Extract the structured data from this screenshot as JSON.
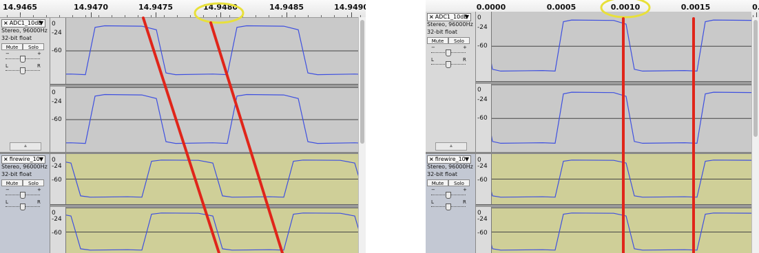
{
  "left": {
    "ruler_labels": [
      "14.9465",
      "14.9470",
      "14.9475",
      "14.9480",
      "14.9485",
      "14.9490"
    ],
    "highlighted_label_index": 3
  },
  "right": {
    "ruler_labels": [
      "0.0000",
      "0.0005",
      "0.0010",
      "0.0015",
      "0."
    ],
    "highlighted_label_index": 2
  },
  "tracks": [
    {
      "name": "ADC1_10dB",
      "info_line1": "Stereo, 96000Hz",
      "info_line2": "32-bit float",
      "mute_label": "Mute",
      "solo_label": "Solo",
      "selected": false
    },
    {
      "name": "firewire_10",
      "info_line1": "Stereo, 96000Hz",
      "info_line2": "32-bit float",
      "mute_label": "Mute",
      "solo_label": "Solo",
      "selected": true
    }
  ],
  "gain_labels": {
    "minus": "−",
    "plus": "+"
  },
  "pan_labels": {
    "left": "L",
    "right": "R"
  },
  "db_labels": [
    "0",
    "-24",
    "-60"
  ],
  "colors": {
    "waveform": "#3d4fe0",
    "annotation_line": "#e0251a",
    "highlight_ellipse": "#e8e03a",
    "track_background": "#c9c9c9",
    "selected_track_background": "#cfcf98"
  }
}
